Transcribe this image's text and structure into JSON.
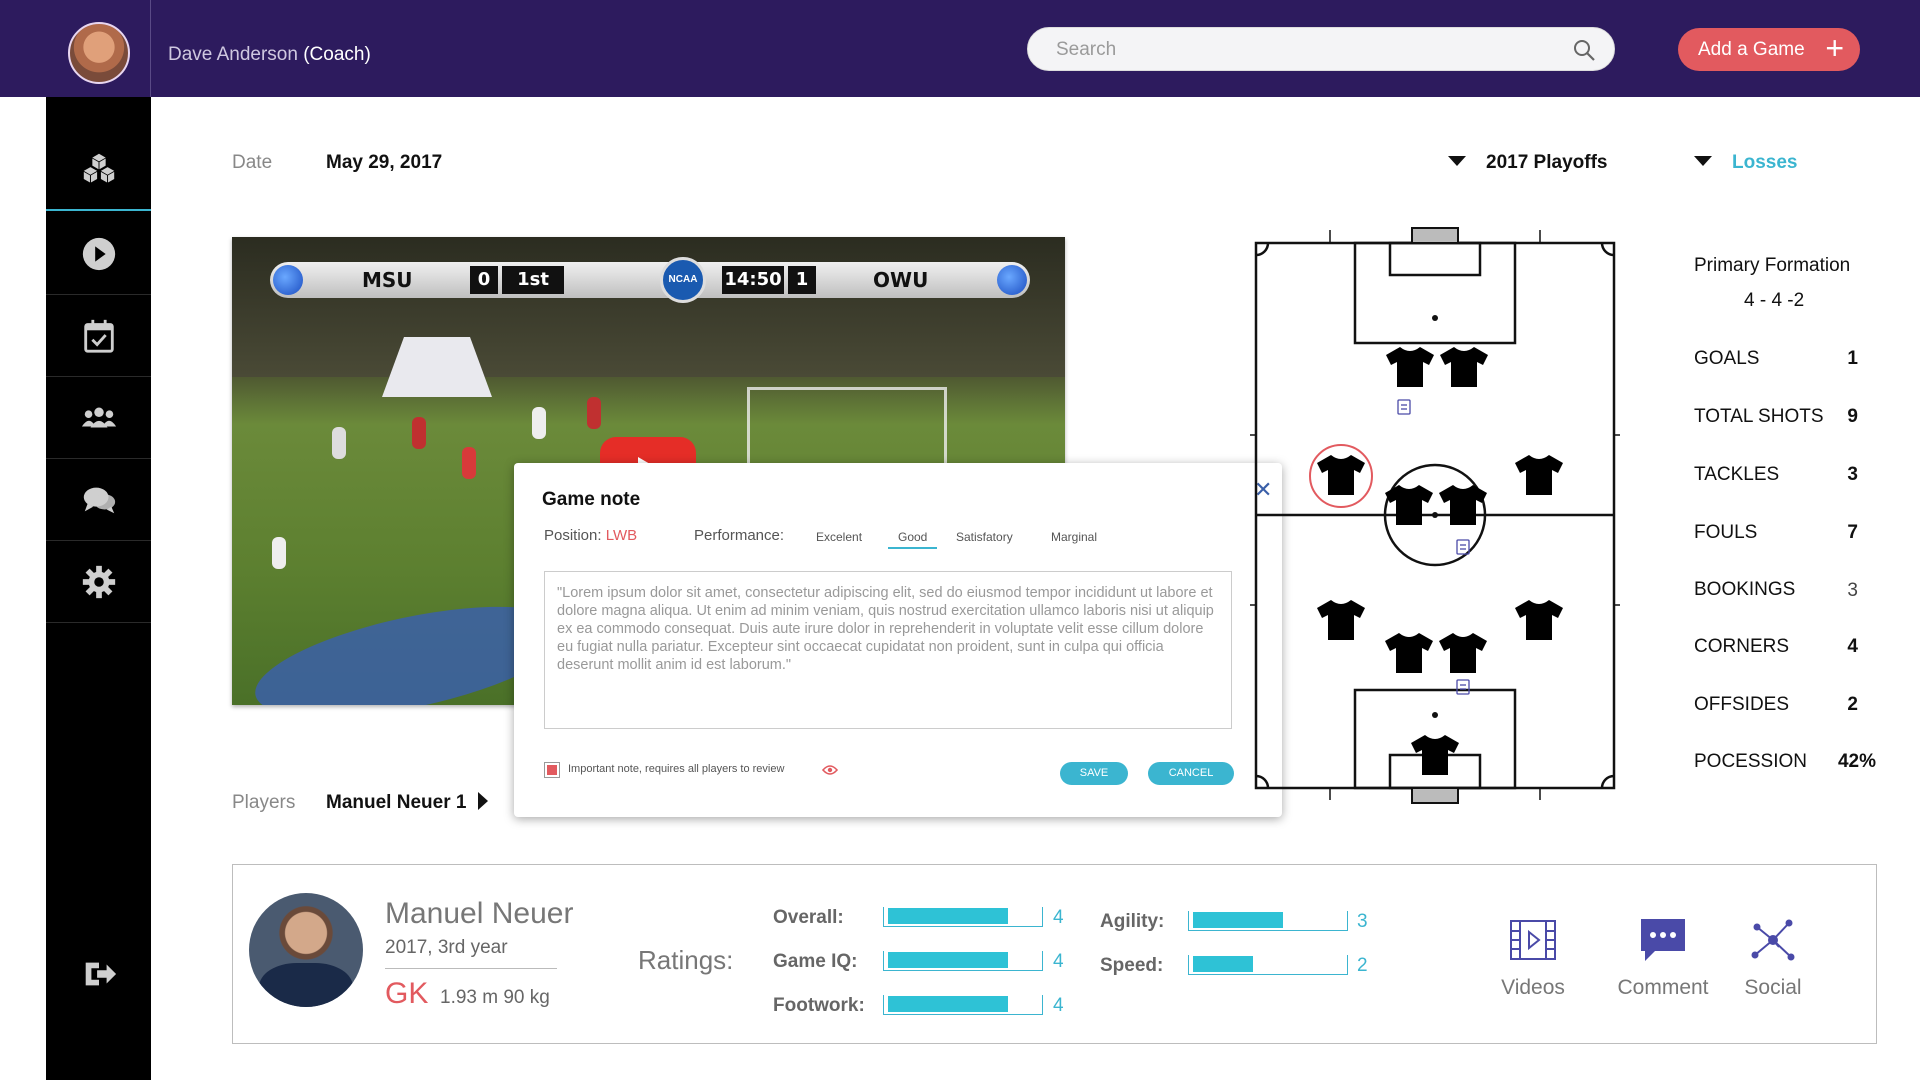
{
  "header": {
    "coach_name": "Dave Anderson",
    "coach_role": "(Coach)",
    "search_placeholder": "Search",
    "add_game_label": "Add a Game"
  },
  "sidebar": {
    "items": [
      {
        "icon": "cubes-icon"
      },
      {
        "icon": "play-icon"
      },
      {
        "icon": "calendar-check-icon"
      },
      {
        "icon": "team-icon"
      },
      {
        "icon": "chat-icon"
      },
      {
        "icon": "gear-icon"
      },
      {
        "icon": "logout-icon"
      }
    ]
  },
  "filters": {
    "date_label": "Date",
    "date_value": "May 29, 2017",
    "season": "2017 Playoffs",
    "result": "Losses"
  },
  "video": {
    "scoreboard": {
      "home_team": "MSU",
      "home_score": "0",
      "period": "1st",
      "clock": "14:50",
      "away_score": "1",
      "away_team": "OWU",
      "badge": "NCAA"
    }
  },
  "note_dialog": {
    "title": "Game note",
    "position_label": "Position:",
    "position_value": "LWB",
    "performance_label": "Performance:",
    "performance_options": [
      "Excelent",
      "Good",
      "Satisfatory",
      "Marginal"
    ],
    "performance_selected": "Good",
    "note_text": "\"Lorem ipsum dolor sit amet, consectetur adipiscing elit, sed do eiusmod tempor incididunt ut labore et dolore magna aliqua. Ut enim ad minim veniam, quis nostrud exercitation ullamco laboris nisi ut aliquip ex ea commodo consequat. Duis aute irure dolor in reprehenderit in voluptate velit esse cillum dolore eu fugiat nulla pariatur. Excepteur sint occaecat cupidatat non proident, sunt in culpa qui officia deserunt mollit anim id est laborum.\"",
    "important_label": "Important note, requires all players to review",
    "important_checked": true,
    "save_label": "SAVE",
    "cancel_label": "CANCEL"
  },
  "players": {
    "label": "Players",
    "selected": "Manuel Neuer 1"
  },
  "stats": {
    "formation_label": "Primary Formation",
    "formation_value": "4 - 4 -2",
    "items": [
      {
        "label": "GOALS",
        "value": "1"
      },
      {
        "label": "TOTAL SHOTS",
        "value": "9"
      },
      {
        "label": "TACKLES",
        "value": "3"
      },
      {
        "label": "FOULS",
        "value": "7"
      },
      {
        "label": "BOOKINGS",
        "value": "3"
      },
      {
        "label": "CORNERS",
        "value": "4"
      },
      {
        "label": "OFFSIDES",
        "value": "2"
      },
      {
        "label": "POCESSION",
        "value": "42%"
      }
    ]
  },
  "player_card": {
    "name": "Manuel Neuer",
    "year": "2017, 3rd year",
    "position": "GK",
    "height_weight": "1.93 m 90 kg",
    "ratings_label": "Ratings:",
    "ratings_max": 5,
    "ratings": [
      {
        "label": "Overall:",
        "value": 4
      },
      {
        "label": "Game IQ:",
        "value": 4
      },
      {
        "label": "Footwork:",
        "value": 4
      },
      {
        "label": "Agility:",
        "value": 3
      },
      {
        "label": "Speed:",
        "value": 2
      }
    ],
    "actions": [
      {
        "label": "Videos",
        "icon": "film-icon"
      },
      {
        "label": "Comment",
        "icon": "comment-icon"
      },
      {
        "label": "Social",
        "icon": "network-icon"
      }
    ]
  },
  "colors": {
    "header_bg": "#2d1b5e",
    "accent": "#3bb5d0",
    "danger": "#e25a5f"
  }
}
